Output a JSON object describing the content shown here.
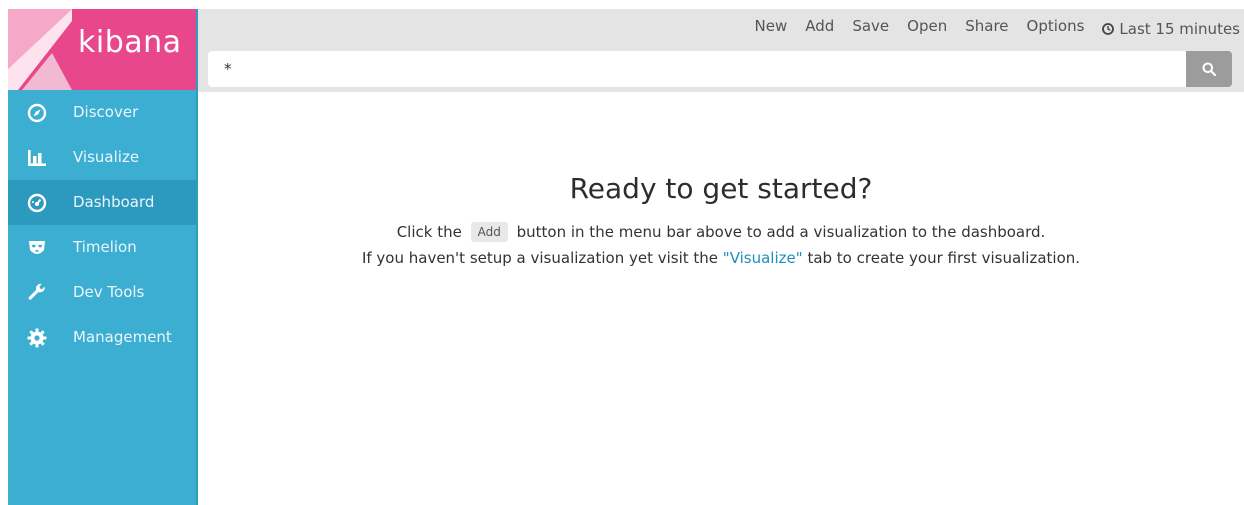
{
  "app": {
    "name": "kibana"
  },
  "colors": {
    "brand_pink": "#e8488b",
    "sidebar_blue": "#3caed2",
    "sidebar_active": "#2c99bf",
    "link": "#1f8fbf"
  },
  "sidebar": {
    "items": [
      {
        "label": "Discover",
        "icon": "compass-icon",
        "active": false
      },
      {
        "label": "Visualize",
        "icon": "bar-chart-icon",
        "active": false
      },
      {
        "label": "Dashboard",
        "icon": "dashboard-gauge-icon",
        "active": true
      },
      {
        "label": "Timelion",
        "icon": "timelion-mask-icon",
        "active": false
      },
      {
        "label": "Dev Tools",
        "icon": "wrench-icon",
        "active": false
      },
      {
        "label": "Management",
        "icon": "gear-icon",
        "active": false
      }
    ]
  },
  "topbar": {
    "menu": {
      "new": "New",
      "add": "Add",
      "save": "Save",
      "open": "Open",
      "share": "Share",
      "options": "Options",
      "time_range": "Last 15 minutes"
    },
    "search": {
      "value": "*"
    }
  },
  "main": {
    "headline": "Ready to get started?",
    "line1_prefix": "Click the",
    "line1_button": "Add",
    "line1_suffix": "button in the menu bar above to add a visualization to the dashboard.",
    "line2_prefix": "If you haven't setup a visualization yet visit the",
    "line2_link": "\"Visualize\"",
    "line2_suffix": "tab to create your first visualization."
  }
}
